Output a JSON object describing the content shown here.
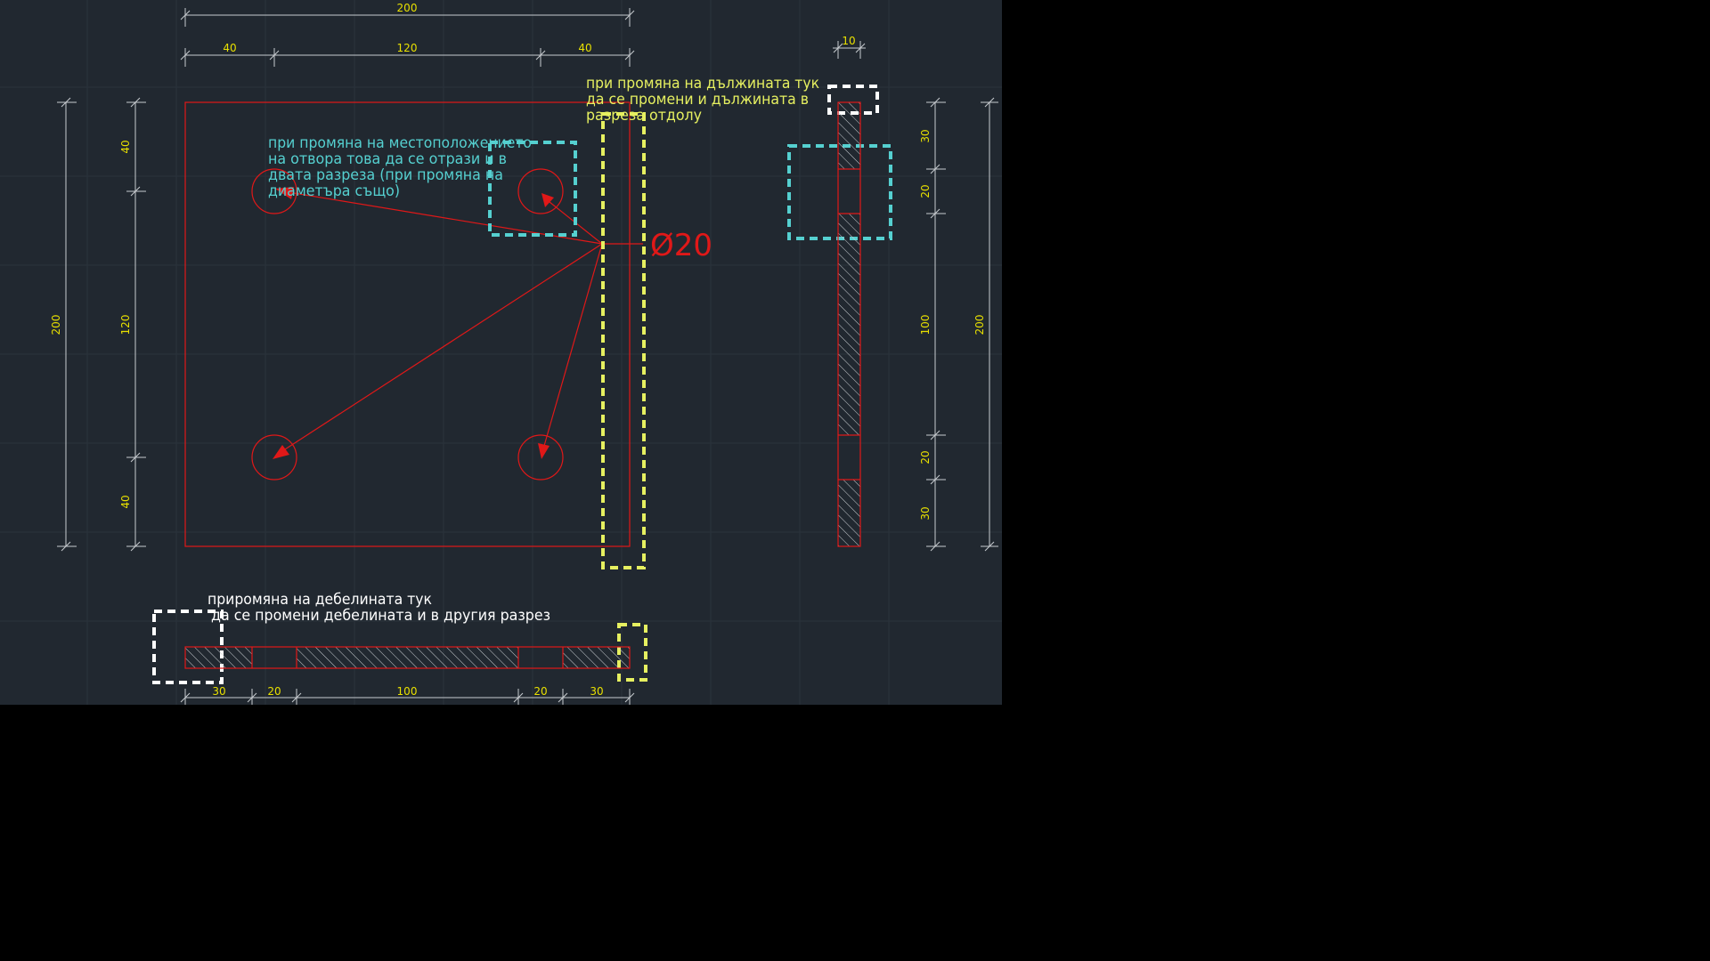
{
  "plan_dims": {
    "top_total": "200",
    "top_left": "40",
    "top_mid": "120",
    "top_right": "40",
    "left_outer": "200",
    "left_top": "40",
    "left_mid": "120",
    "left_bottom": "40"
  },
  "side_dims": {
    "thickness": "10",
    "seg_30_top": "30",
    "seg_20_top": "20",
    "seg_100": "100",
    "seg_20_bottom": "20",
    "seg_30_bottom": "30",
    "total": "200"
  },
  "bottom_dims": {
    "seg_30_left": "30",
    "seg_20_left": "20",
    "seg_100": "100",
    "seg_20_right": "20",
    "seg_30_right": "30"
  },
  "diameter_label": "Ø20",
  "notes": {
    "cyan": [
      "при промяна на местоположението",
      "на отвора това да се отрази и в",
      "двата разреза (при промяна на",
      "диаметъра също)"
    ],
    "yellow": [
      "при промяна на дължината тук",
      "да се промени и дължината в",
      "разреза отдолу"
    ],
    "white": [
      "приромяна на дебелината тук",
      "да се промени дебелината и в другия разрез"
    ]
  },
  "colors": {
    "background": "#212830",
    "outline": "#e01818",
    "dimension_text": "#e8e000",
    "note_cyan": "#55d0d0",
    "note_yellow": "#e6f060",
    "note_white": "#ffffff"
  }
}
